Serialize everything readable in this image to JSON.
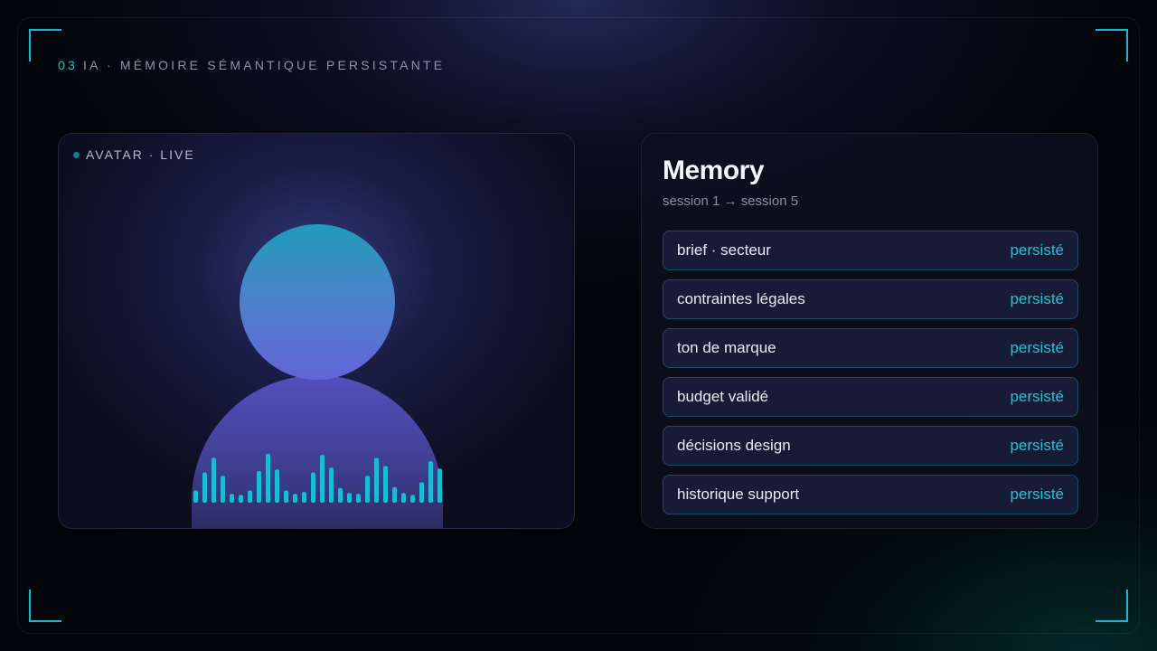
{
  "section": {
    "number": "03",
    "title": "IA · MÉMOIRE SÉMANTIQUE PERSISTANTE"
  },
  "avatar": {
    "live_label": "AVATAR · LIVE",
    "audio_levels": [
      0.25,
      0.62,
      0.92,
      0.55,
      0.18,
      0.16,
      0.25,
      0.65,
      1.0,
      0.68,
      0.25,
      0.18,
      0.22,
      0.62,
      0.98,
      0.72,
      0.3,
      0.2,
      0.18,
      0.55,
      0.92,
      0.75,
      0.32,
      0.2,
      0.16,
      0.42,
      0.85,
      0.7
    ],
    "colors": {
      "accent": "#19bdd3",
      "live_dot": "#127e8c"
    }
  },
  "memory": {
    "title": "Memory",
    "subtitle": "session 1 → session 5",
    "items": [
      {
        "label": "brief · secteur",
        "status": "persisté"
      },
      {
        "label": "contraintes légales",
        "status": "persisté"
      },
      {
        "label": "ton de marque",
        "status": "persisté"
      },
      {
        "label": "budget validé",
        "status": "persisté"
      },
      {
        "label": "décisions design",
        "status": "persisté"
      },
      {
        "label": "historique support",
        "status": "persisté"
      }
    ]
  },
  "colors": {
    "accent": "#19bdd3",
    "background": "#020409",
    "item_background": "#181b36"
  }
}
